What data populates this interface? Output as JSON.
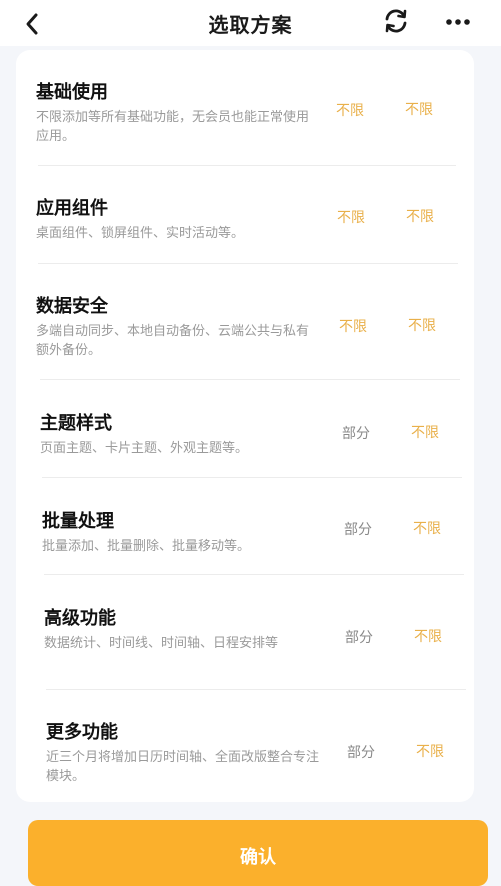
{
  "header": {
    "title": "选取方案",
    "back_icon": "chevron-left-icon",
    "refresh_icon": "refresh-icon",
    "more_icon": "more-dots-icon"
  },
  "rows": [
    {
      "title": "基础使用",
      "desc": "不限添加等所有基础功能，无会员也能正常使用应用。",
      "v1": "不限",
      "v2": "不限"
    },
    {
      "title": "应用组件",
      "desc": "桌面组件、锁屏组件、实时活动等。",
      "v1": "不限",
      "v2": "不限"
    },
    {
      "title": "数据安全",
      "desc": "多端自动同步、本地自动备份、云端公共与私有额外备份。",
      "v1": "不限",
      "v2": "不限"
    },
    {
      "title": "主题样式",
      "desc": "页面主题、卡片主题、外观主题等。",
      "v1": "部分",
      "v2": "不限"
    },
    {
      "title": "批量处理",
      "desc": "批量添加、批量删除、批量移动等。",
      "v1": "部分",
      "v2": "不限"
    },
    {
      "title": "高级功能",
      "desc": "数据统计、时间线、时间轴、日程安排等",
      "v1": "部分",
      "v2": "不限"
    },
    {
      "title": "更多功能",
      "desc": "近三个月将增加日历时间轴、全面改版整合专注模块。",
      "v1": "部分",
      "v2": "不限"
    }
  ],
  "confirm_label": "确认",
  "colors": {
    "accent": "#fbb02c",
    "gold_text": "#e9b04a",
    "gray_text": "#8a8a8a",
    "background": "#f4f6fa"
  }
}
